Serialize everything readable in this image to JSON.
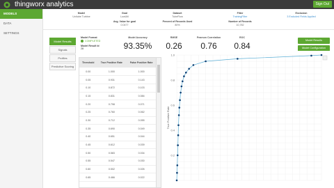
{
  "app": {
    "logo_text": "thingworx analytics",
    "sign_out": "Sign Out"
  },
  "sidebar": {
    "items": [
      {
        "label": "MODELS",
        "active": true
      },
      {
        "label": "DATA",
        "active": false
      },
      {
        "label": "SETTINGS",
        "active": false
      }
    ]
  },
  "info": {
    "model": {
      "label": "Model",
      "value": "Unitube Turbine"
    },
    "goal": {
      "label": "Goal",
      "value": "LowUtil"
    },
    "dataset": {
      "label": "Dataset",
      "value": "TubeFlow"
    },
    "filter": {
      "label": "Filter",
      "value": "TrainingFilter"
    },
    "exclusion": {
      "label": "Exclusion",
      "value": "3 Excluded Fields Applied"
    },
    "avg_goal": {
      "label": "Avg. Value for goal",
      "value": "0.0477"
    },
    "pct_records": {
      "label": "Percent of Records Used",
      "value": "80%"
    },
    "num_records": {
      "label": "Number of Records",
      "value": "10,782"
    }
  },
  "nav": {
    "buttons": [
      "Model Results",
      "Signals",
      "Profiles",
      "Predictive Scoring"
    ],
    "active_index": 0
  },
  "model_info": {
    "format_label": "Model Format",
    "format_value": "COMPLETED",
    "result_label": "Model Result Id",
    "result_value": "28"
  },
  "metrics": [
    {
      "label": "Model Accuracy",
      "value": "93.35%"
    },
    {
      "label": "RMSE",
      "value": "0.26"
    },
    {
      "label": "Pearson Correlation",
      "value": "0.76"
    },
    {
      "label": "ROC",
      "value": "0.84"
    }
  ],
  "buttons": {
    "results": "Model Results",
    "configuration": "Model Configuration"
  },
  "table": {
    "headers": [
      "Threshold",
      "True Positive Rate",
      "False Positive Rate"
    ],
    "rows": [
      [
        "0.00",
        "1.000",
        "1.000"
      ],
      [
        "0.05",
        "0.931",
        "0.143"
      ],
      [
        "0.10",
        "0.872",
        "0.103"
      ],
      [
        "0.15",
        "0.831",
        "0.084"
      ],
      [
        "0.20",
        "0.798",
        "0.071"
      ],
      [
        "0.25",
        "0.760",
        "0.062"
      ],
      [
        "0.30",
        "0.712",
        "0.055"
      ],
      [
        "0.35",
        "0.690",
        "0.049"
      ],
      [
        "0.40",
        "0.651",
        "0.044"
      ],
      [
        "0.45",
        "0.612",
        "0.039"
      ],
      [
        "0.50",
        "0.583",
        "0.034"
      ],
      [
        "0.55",
        "0.547",
        "0.030"
      ],
      [
        "0.60",
        "0.502",
        "0.026"
      ],
      [
        "0.65",
        "0.466",
        "0.022"
      ]
    ]
  },
  "chart_data": {
    "type": "line",
    "ylabel": "True Positive Rate",
    "xlim": [
      0,
      1
    ],
    "ylim": [
      0,
      1
    ],
    "yticks": [
      "1.0",
      "0.8",
      "0.6",
      "0.4",
      "0.2"
    ],
    "grid": true,
    "series": [
      {
        "color": "#5aaed6",
        "x": [
          0.0,
          0.002,
          0.004,
          0.006,
          0.008,
          0.01,
          0.012,
          0.015,
          0.018,
          0.022,
          0.027,
          0.033,
          0.04,
          0.05,
          0.064,
          0.085,
          0.115,
          0.2,
          0.42,
          0.93,
          1.0
        ],
        "y": [
          0.0,
          0.06,
          0.12,
          0.2,
          0.28,
          0.36,
          0.44,
          0.52,
          0.58,
          0.64,
          0.7,
          0.75,
          0.79,
          0.83,
          0.86,
          0.89,
          0.92,
          0.95,
          0.97,
          0.995,
          1.0
        ]
      }
    ]
  }
}
